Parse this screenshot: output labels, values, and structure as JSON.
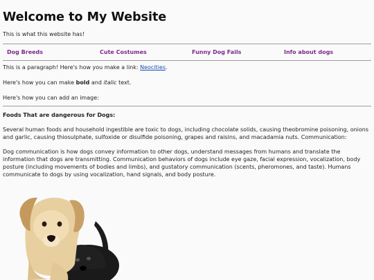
{
  "page": {
    "title": "Welcome to My Website",
    "intro": "This is what this website has!"
  },
  "nav": {
    "items": [
      {
        "label": "Dog Breeds"
      },
      {
        "label": "Cute Costumes"
      },
      {
        "label": "Funny Dog Fails"
      },
      {
        "label": "Info about dogs"
      }
    ]
  },
  "content": {
    "link_para_prefix": "This is a paragraph! Here's how you make a link: ",
    "link_text": "Neocities",
    "link_para_suffix": ".",
    "bold_prefix": "Here's how you can make ",
    "bold_word": "bold",
    "bold_mid": " and ",
    "italic_word": "italic",
    "bold_suffix": " text.",
    "image_line": "Here's how you can add an image:",
    "section_heading": "Foods That are dangerous for Dogs:",
    "foods_para": "Several human foods and household ingestible are toxic to dogs, including chocolate solids, causing theobromine poisoning, onions and garlic, causing thiosulphate, sulfoxide or disulfide poisoning, grapes and raisins, and macadamia nuts. Communication:",
    "comm_para": "Dog communication is how dogs convey information to other dogs, understand messages from humans and translate the information that dogs are transmitting. Communication behaviors of dogs include eye gaze, facial expression, vocalization, body posture (including movements of bodies and limbs), and gustatory communication (scents, pheromones, and taste). Humans communicate to dogs by using vocalization, hand signals, and body posture."
  },
  "image": {
    "subject": "puppies-photo"
  },
  "colors": {
    "nav_link": "#7c2a8a",
    "link": "#1a4fb0",
    "background": "#fafafa"
  }
}
